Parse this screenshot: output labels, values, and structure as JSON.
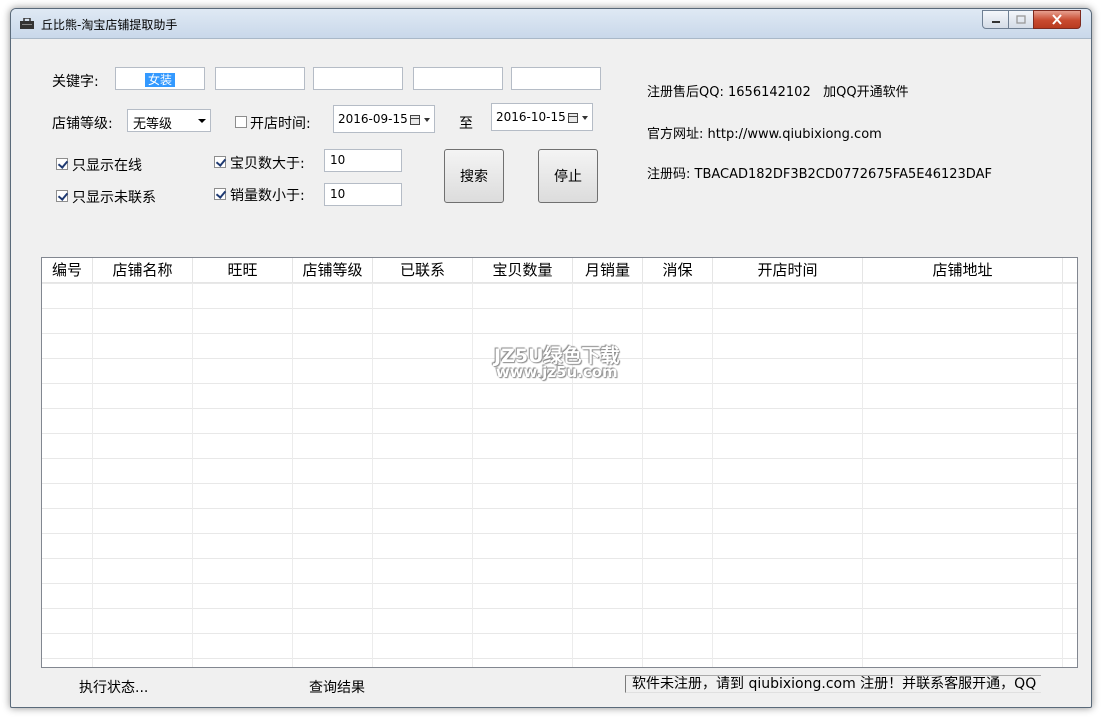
{
  "window": {
    "title": "丘比熊-淘宝店铺提取助手"
  },
  "search": {
    "keyword_label": "关键字:",
    "keywords": [
      "女装",
      "",
      "",
      "",
      ""
    ],
    "level_label": "店铺等级:",
    "level_value": "无等级",
    "open_time_label": "开店时间:",
    "open_time_checked": false,
    "date_from": "2016-09-15",
    "to_label": "至",
    "date_to": "2016-10-15",
    "online_only_label": "只显示在线",
    "online_only_checked": true,
    "uncontacted_only_label": "只显示未联系",
    "uncontacted_only_checked": true,
    "items_gt_label": "宝贝数大于:",
    "items_gt_checked": true,
    "items_gt_value": "10",
    "sales_lt_label": "销量数小于:",
    "sales_lt_checked": true,
    "sales_lt_value": "10",
    "search_button": "搜索",
    "stop_button": "停止"
  },
  "info": {
    "qq_label": "注册售后QQ:",
    "qq_value": "1656142102",
    "qq_note": "加QQ开通软件",
    "website_label": "官方网址:",
    "website_value": "http://www.qiubixiong.com",
    "regcode_label": "注册码:",
    "regcode_value": "TBACAD182DF3B2CD0772675FA5E46123DAF"
  },
  "table": {
    "columns": [
      "编号",
      "店铺名称",
      "旺旺",
      "店铺等级",
      "已联系",
      "宝贝数量",
      "月销量",
      "消保",
      "开店时间",
      "店铺地址"
    ],
    "rows": []
  },
  "watermark": {
    "line1": "JZ5U绿色下载",
    "line2": "www.jz5u.com"
  },
  "status": {
    "exec_state": "执行状态...",
    "query_result": "查询结果",
    "message": "软件未注册，请到 qiubixiong.com 注册！并联系客服开通，QQ"
  }
}
